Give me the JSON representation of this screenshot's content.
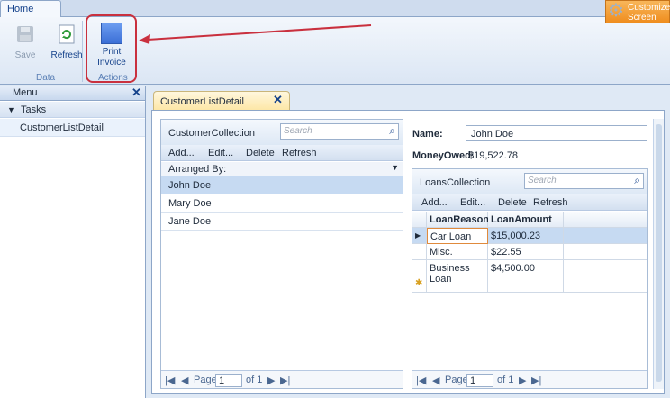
{
  "ribbon": {
    "tab": "Home",
    "buttons": {
      "save": "Save",
      "refresh": "Refresh",
      "print": "Print Invoice"
    },
    "groups": {
      "data": "Data",
      "actions": "Actions"
    },
    "customize": "Customize Screen"
  },
  "menu": {
    "title": "Menu",
    "tasks": "Tasks",
    "item": "CustomerListDetail"
  },
  "screen": {
    "tab": "CustomerListDetail"
  },
  "customers": {
    "title": "CustomerCollection",
    "search_placeholder": "Search",
    "toolbar": {
      "add": "Add...",
      "edit": "Edit...",
      "delete": "Delete",
      "refresh": "Refresh"
    },
    "arranged_by": "Arranged By:",
    "rows": [
      "John Doe",
      "Mary Doe",
      "Jane Doe"
    ],
    "pager": {
      "page_label": "Page",
      "page": "1",
      "of": "of 1"
    }
  },
  "detail": {
    "name_label": "Name:",
    "name_value": "John Doe",
    "money_label": "MoneyOwed:",
    "money_value": "$19,522.78"
  },
  "loans": {
    "title": "LoansCollection",
    "search_placeholder": "Search",
    "toolbar": {
      "add": "Add...",
      "edit": "Edit...",
      "delete": "Delete",
      "refresh": "Refresh"
    },
    "columns": [
      "LoanReason",
      "LoanAmount"
    ],
    "rows": [
      {
        "reason": "Car Loan",
        "amount": "$15,000.23"
      },
      {
        "reason": "Misc.",
        "amount": "$22.55"
      },
      {
        "reason": "Business Loan",
        "amount": "$4,500.00"
      }
    ],
    "pager": {
      "page_label": "Page",
      "page": "1",
      "of": "of 1"
    }
  },
  "colors": {
    "accent": "#15428b",
    "highlight": "#c9303e",
    "selection": "#c6daf2"
  }
}
